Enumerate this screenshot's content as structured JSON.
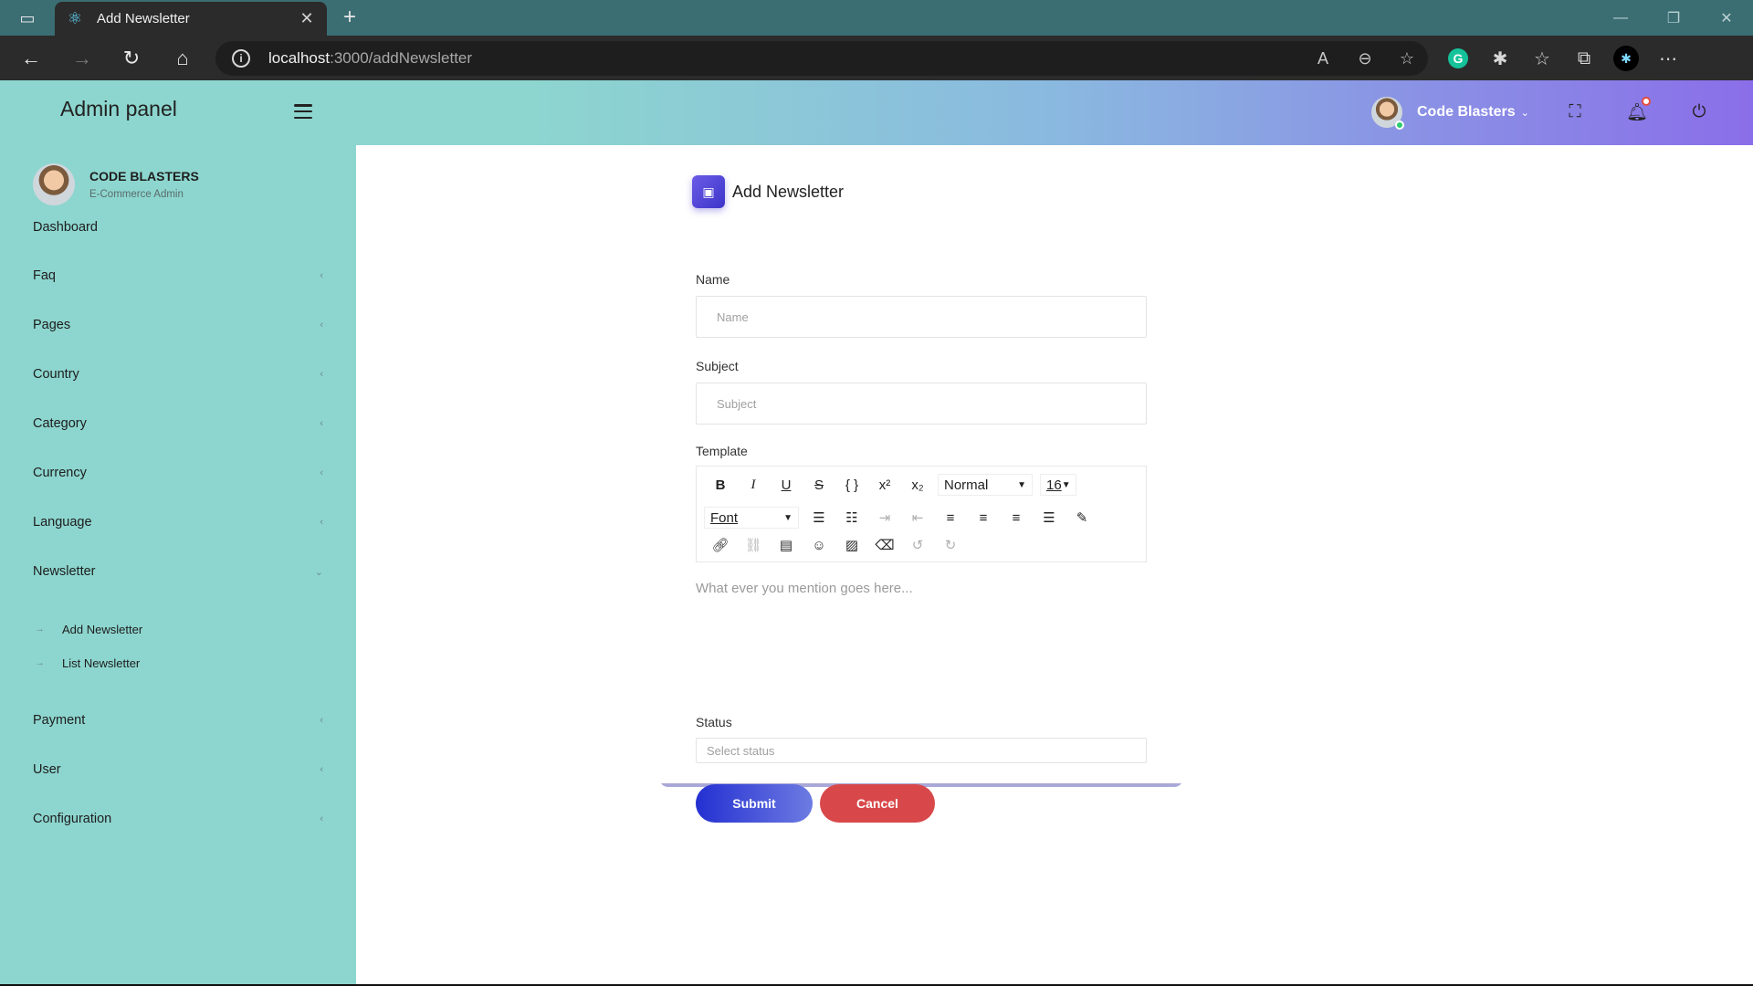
{
  "browser": {
    "tab_title": "Add Newsletter",
    "url_host": "localhost",
    "url_path": ":3000/addNewsletter"
  },
  "app": {
    "brand": "Admin panel",
    "top_user_name": "Code Blasters"
  },
  "sidebar": {
    "user_name": "CODE BLASTERS",
    "user_role": "E-Commerce Admin",
    "items": [
      {
        "label": "Dashboard"
      },
      {
        "label": "Faq"
      },
      {
        "label": "Pages"
      },
      {
        "label": "Country"
      },
      {
        "label": "Category"
      },
      {
        "label": "Currency"
      },
      {
        "label": "Language"
      },
      {
        "label": "Newsletter"
      },
      {
        "label": "Payment"
      },
      {
        "label": "User"
      },
      {
        "label": "Configuration"
      }
    ],
    "newsletter_sub": [
      {
        "label": "Add Newsletter"
      },
      {
        "label": "List Newsletter"
      }
    ]
  },
  "form": {
    "title": "Add Newsletter",
    "name_label": "Name",
    "name_placeholder": "Name",
    "subject_label": "Subject",
    "subject_placeholder": "Subject",
    "template_label": "Template",
    "heading_select": "Normal",
    "size_select": "16",
    "font_select": "Font",
    "editor_placeholder": "What ever you mention goes here...",
    "status_label": "Status",
    "status_placeholder": "Select status",
    "submit_label": "Submit",
    "cancel_label": "Cancel"
  }
}
